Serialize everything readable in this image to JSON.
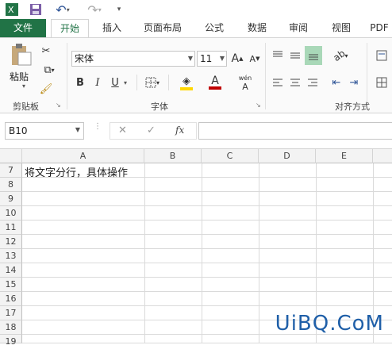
{
  "qat": {
    "undo_hint": "",
    "redo_hint": ""
  },
  "tabs": [
    "文件",
    "开始",
    "插入",
    "页面布局",
    "公式",
    "数据",
    "审阅",
    "视图",
    "PDF"
  ],
  "ribbon": {
    "paste_label": "粘贴",
    "clipboard_group": "剪贴板",
    "font_group": "字体",
    "align_group": "对齐方式",
    "font_name": "宋体",
    "font_size": "11",
    "bold": "B",
    "italic": "I",
    "underline": "U",
    "grow_font": "A",
    "shrink_font": "A",
    "phonetic_top": "wén",
    "phonetic_bottom": "A"
  },
  "formula_bar": {
    "name_box": "B10",
    "cancel": "✕",
    "enter": "✓",
    "fx": "fx",
    "content": ""
  },
  "columns": [
    "A",
    "B",
    "C",
    "D",
    "E"
  ],
  "rows": [
    "7",
    "8",
    "9",
    "10",
    "11",
    "12",
    "13",
    "14",
    "15",
    "16",
    "17",
    "18",
    "19"
  ],
  "cells": {
    "A7": "将文字分行，具体操作"
  },
  "watermark": "UiBQ.CoM",
  "colors": {
    "excel_green": "#217346",
    "font_color_red": "#c00000",
    "highlight_yellow": "#ffd700"
  }
}
